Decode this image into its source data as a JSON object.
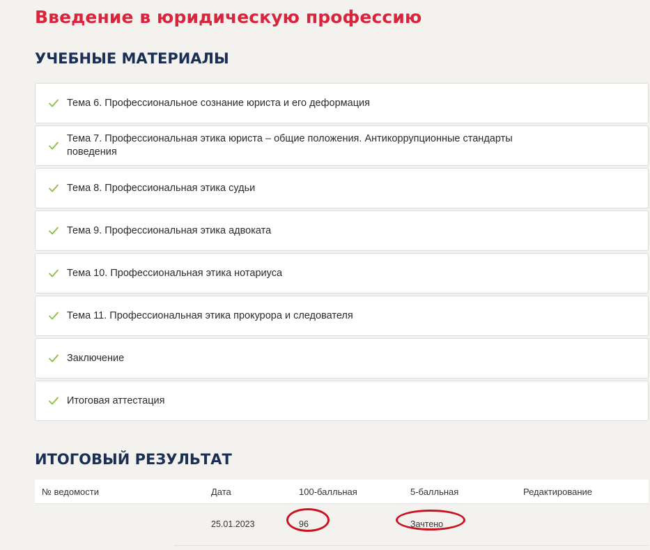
{
  "page": {
    "title": "Введение в юридическую профессию"
  },
  "materials_section": {
    "heading": "УЧЕБНЫЕ МАТЕРИАЛЫ",
    "check_icon_color": "#8cbf3f",
    "items": [
      {
        "label": "Тема 6. Профессиональное сознание юриста и его деформация",
        "completed": true
      },
      {
        "label": "Тема 7. Профессиональная этика юриста – общие положения. Антикоррупционные стандарты поведения",
        "completed": true
      },
      {
        "label": "Тема 8. Профессиональная этика судьи",
        "completed": true
      },
      {
        "label": "Тема 9. Профессиональная этика адвоката",
        "completed": true
      },
      {
        "label": "Тема 10. Профессиональная этика нотариуса",
        "completed": true
      },
      {
        "label": "Тема 11. Профессиональная этика прокурора и следователя",
        "completed": true
      },
      {
        "label": "Заключение",
        "completed": true
      },
      {
        "label": "Итоговая аттестация",
        "completed": true
      }
    ]
  },
  "results_section": {
    "heading": "ИТОГОВЫЙ РЕЗУЛЬТАТ",
    "columns": [
      "№ ведомости",
      "Дата",
      "100-балльная",
      "5-балльная",
      "Редактирование"
    ],
    "rows": [
      {
        "statement_no": "",
        "date": "25.01.2023",
        "score_100": "96",
        "score_5": "Зачтено",
        "edit": ""
      }
    ]
  },
  "colors": {
    "title": "#d8243d",
    "heading": "#1b2f55",
    "background": "#f3f2ef",
    "annotation": "#c8141e"
  }
}
